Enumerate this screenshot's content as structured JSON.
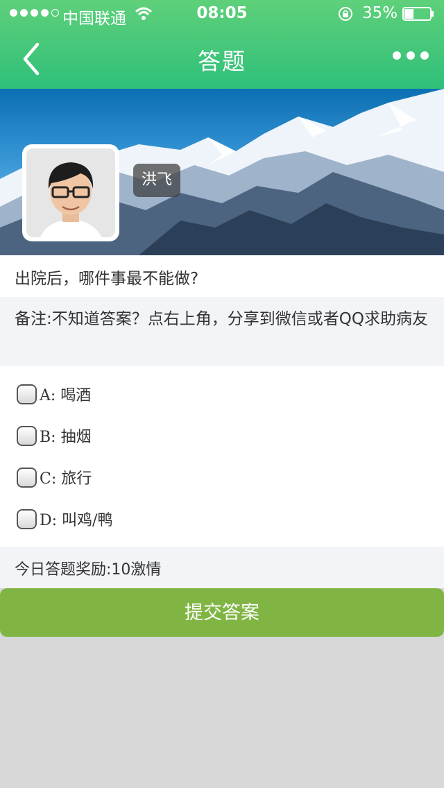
{
  "status_bar": {
    "carrier": "中国联通",
    "time": "08:05",
    "battery": "35%",
    "battery_level": 0.35,
    "signal_bars": 4
  },
  "nav": {
    "title": "答题",
    "back_icon": "chevron-left-icon",
    "more_icon": "more-dots-icon"
  },
  "profile": {
    "name": "洪飞"
  },
  "question": {
    "text": "出院后，哪件事最不能做?",
    "note": "备注:不知道答案？点右上角，分享到微信或者QQ求助病友"
  },
  "options": [
    {
      "label": "A: 喝酒",
      "checked": false
    },
    {
      "label": "B: 抽烟",
      "checked": false
    },
    {
      "label": "C: 旅行",
      "checked": false
    },
    {
      "label": "D: 叫鸡/鸭",
      "checked": false
    }
  ],
  "reward": "今日答题奖励:10激情",
  "submit_label": "提交答案",
  "colors": {
    "header_green": "#3cc57a",
    "submit_green": "#80b544",
    "note_bg": "#f3f4f8"
  }
}
